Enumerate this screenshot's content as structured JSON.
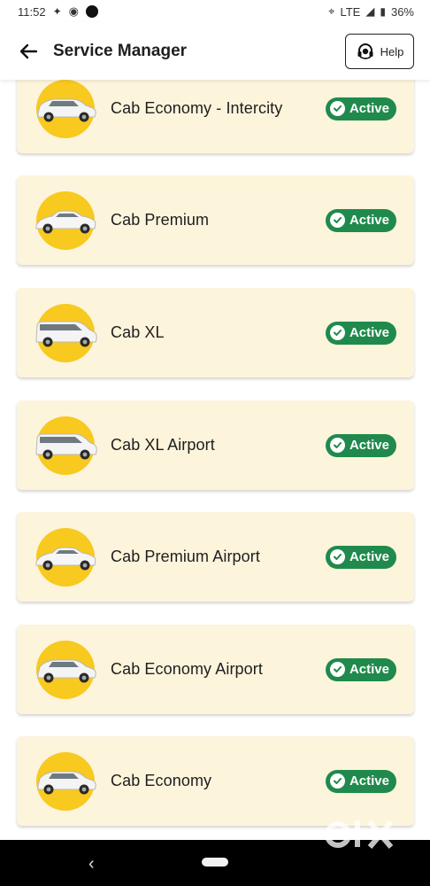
{
  "status_bar": {
    "time": "11:52",
    "network": "LTE",
    "battery": "36%"
  },
  "header": {
    "title": "Service Manager",
    "help_label": "Help"
  },
  "services": [
    {
      "name": "Cab Economy - Intercity",
      "status": "Active"
    },
    {
      "name": "Cab Premium",
      "status": "Active"
    },
    {
      "name": "Cab XL",
      "status": "Active"
    },
    {
      "name": "Cab XL Airport",
      "status": "Active"
    },
    {
      "name": "Cab Premium Airport",
      "status": "Active"
    },
    {
      "name": "Cab Economy Airport",
      "status": "Active"
    },
    {
      "name": "Cab Economy",
      "status": "Active"
    }
  ],
  "colors": {
    "card_bg": "#fdf4dc",
    "avatar_bg": "#f8c91e",
    "active_badge": "#1f8a4c"
  },
  "watermark": "OLX"
}
